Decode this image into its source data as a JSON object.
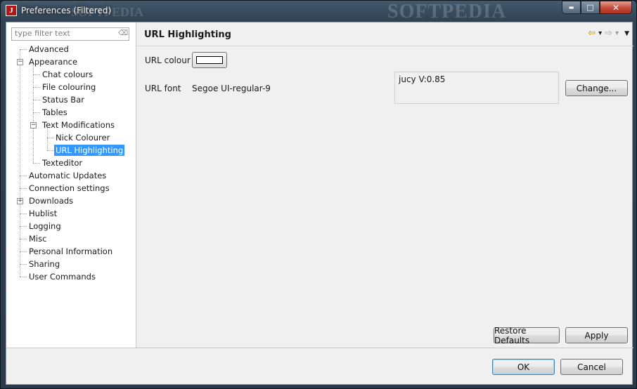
{
  "window": {
    "title": "Preferences (Filtered)",
    "app_icon_letter": "J",
    "watermark": "SOFTPEDIA",
    "watermark_small": "SOFTPEDIA",
    "minimize_glyph": "▬",
    "maximize_glyph": "□",
    "close_glyph": "✕"
  },
  "filter": {
    "placeholder": "type filter text",
    "clear_glyph": "⌫"
  },
  "tree": {
    "items": [
      {
        "label": "Advanced"
      },
      {
        "label": "Appearance",
        "expanded": true
      },
      {
        "label": "Chat colours"
      },
      {
        "label": "File colouring"
      },
      {
        "label": "Status Bar"
      },
      {
        "label": "Tables"
      },
      {
        "label": "Text Modifications",
        "expanded": true
      },
      {
        "label": "Nick Colourer"
      },
      {
        "label": "URL Highlighting",
        "selected": true
      },
      {
        "label": "Texteditor"
      },
      {
        "label": "Automatic Updates"
      },
      {
        "label": "Connection settings"
      },
      {
        "label": "Downloads",
        "expanded": false
      },
      {
        "label": "Hublist"
      },
      {
        "label": "Logging"
      },
      {
        "label": "Misc"
      },
      {
        "label": "Personal Information"
      },
      {
        "label": "Sharing"
      },
      {
        "label": "User Commands"
      }
    ],
    "expanded_glyph": "−",
    "collapsed_glyph": "+"
  },
  "page": {
    "title": "URL Highlighting",
    "url_colour_label": "URL colour",
    "url_colour_value": "#ffffff",
    "url_font_label": "URL font",
    "url_font_value": "Segoe UI-regular-9",
    "preview_text": "jucy V:0.85",
    "change_button": "Change...",
    "restore_defaults_button": "Restore Defaults",
    "apply_button": "Apply"
  },
  "nav": {
    "back_glyph": "⇦",
    "forward_glyph": "⇨",
    "dropdown_glyph": "▾",
    "menu_glyph": "▼",
    "back_color": "#e0a800",
    "forward_color": "#b9b9b9"
  },
  "footer": {
    "ok_button": "OK",
    "cancel_button": "Cancel"
  }
}
